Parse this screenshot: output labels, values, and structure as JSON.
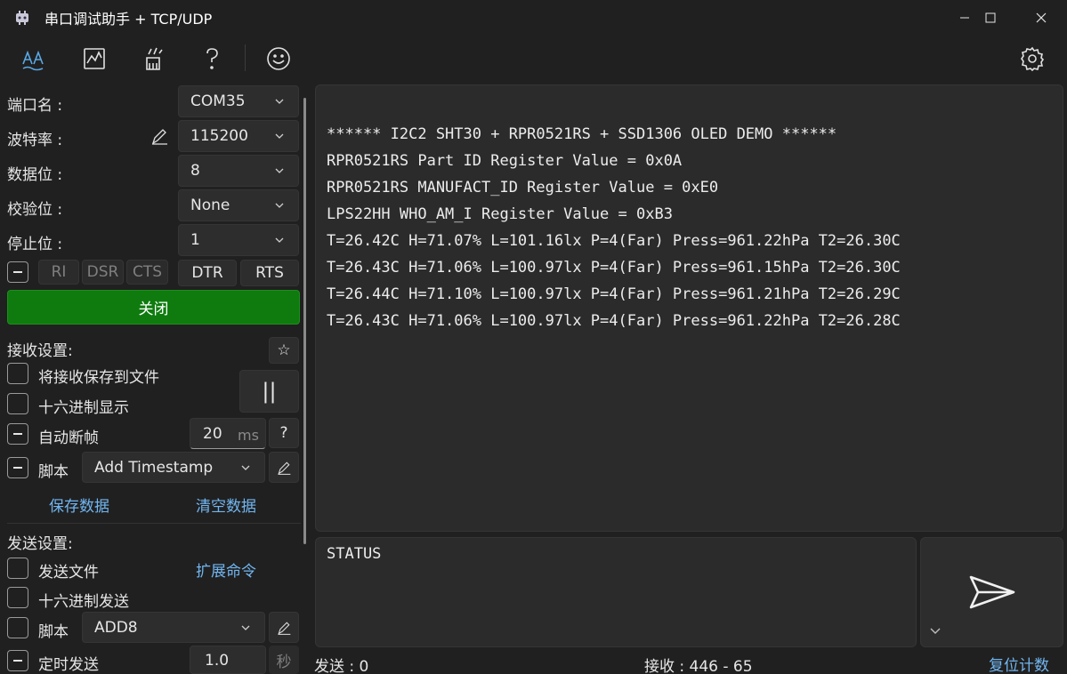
{
  "window": {
    "title": "串口调试助手 + TCP/UDP"
  },
  "toolbar": {
    "icons": [
      "serial-text-icon",
      "chart-icon",
      "clean-icon",
      "help-icon",
      "smiley-icon",
      "settings-icon"
    ]
  },
  "port": {
    "port_label": "端口名 :",
    "port_value": "COM35",
    "baud_label": "波特率 :",
    "baud_value": "115200",
    "databits_label": "数据位 :",
    "databits_value": "8",
    "parity_label": "校验位 :",
    "parity_value": "None",
    "stopbits_label": "停止位 :",
    "stopbits_value": "1"
  },
  "signals": {
    "ri": "RI",
    "dsr": "DSR",
    "cts": "CTS",
    "dtr": "DTR",
    "rts": "RTS"
  },
  "open_close_button": "关闭",
  "receive_settings": {
    "title": "接收设置:",
    "save_to_file": "将接收保存到文件",
    "hex_display": "十六进制显示",
    "auto_frame": "自动断帧",
    "auto_frame_value": "20",
    "auto_frame_unit": "ms",
    "help": "?",
    "script_label": "脚本",
    "script_value": "Add Timestamp",
    "pause": "||",
    "save_data": "保存数据",
    "clear_data": "清空数据",
    "star": "☆"
  },
  "send_settings": {
    "title": "发送设置:",
    "send_file": "发送文件",
    "ext_commands": "扩展命令",
    "hex_send": "十六进制发送",
    "script_label": "脚本",
    "script_value": "ADD8",
    "timed_send": "定时发送",
    "timed_value": "1.0",
    "timed_unit": "秒"
  },
  "receive_area": {
    "lines": [
      "****** I2C2 SHT30 + RPR0521RS + SSD1306 OLED DEMO ******",
      "RPR0521RS Part ID Register Value = 0x0A",
      "RPR0521RS MANUFACT_ID Register Value = 0xE0",
      "LPS22HH WHO_AM_I Register Value = 0xB3",
      "T=26.42C H=71.07% L=101.16lx P=4(Far) Press=961.22hPa T2=26.30C",
      "T=26.43C H=71.06% L=100.97lx P=4(Far) Press=961.15hPa T2=26.30C",
      "T=26.44C H=71.10% L=100.97lx P=4(Far) Press=961.21hPa T2=26.29C",
      "T=26.43C H=71.06% L=100.97lx P=4(Far) Press=961.22hPa T2=26.28C"
    ]
  },
  "send_area": {
    "text": "STATUS"
  },
  "status_bar": {
    "sent": "发送 : 0",
    "received": "接收 : 446 - 65",
    "reset": "复位计数"
  },
  "colors": {
    "accent_green": "#0f7b0f",
    "link_blue": "#71b6f1",
    "toolbar_active": "#5aa9e6"
  }
}
